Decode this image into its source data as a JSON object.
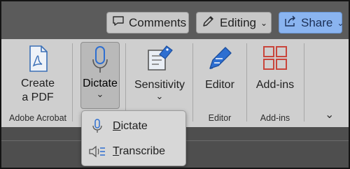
{
  "header": {
    "comments_label": "Comments",
    "editing_label": "Editing",
    "share_label": "Share"
  },
  "ribbon": {
    "create_pdf": {
      "line1": "Create",
      "line2": "a PDF"
    },
    "dictate_label": "Dictate",
    "sensitivity_label": "Sensitivity",
    "editor_label": "Editor",
    "addins_label": "Add-ins",
    "groups": {
      "adobe": "Adobe Acrobat",
      "editor": "Editor",
      "addins": "Add-ins"
    }
  },
  "dropdown": {
    "items": [
      {
        "first": "D",
        "rest": "ictate",
        "icon": "microphone-icon"
      },
      {
        "first": "T",
        "rest": "ranscribe",
        "icon": "transcribe-icon"
      }
    ]
  },
  "colors": {
    "share_bg": "#8ab4f0",
    "editor_blue": "#2e6fd1",
    "addins_red": "#c9453b",
    "pdf_blue": "#3b6fb6"
  }
}
